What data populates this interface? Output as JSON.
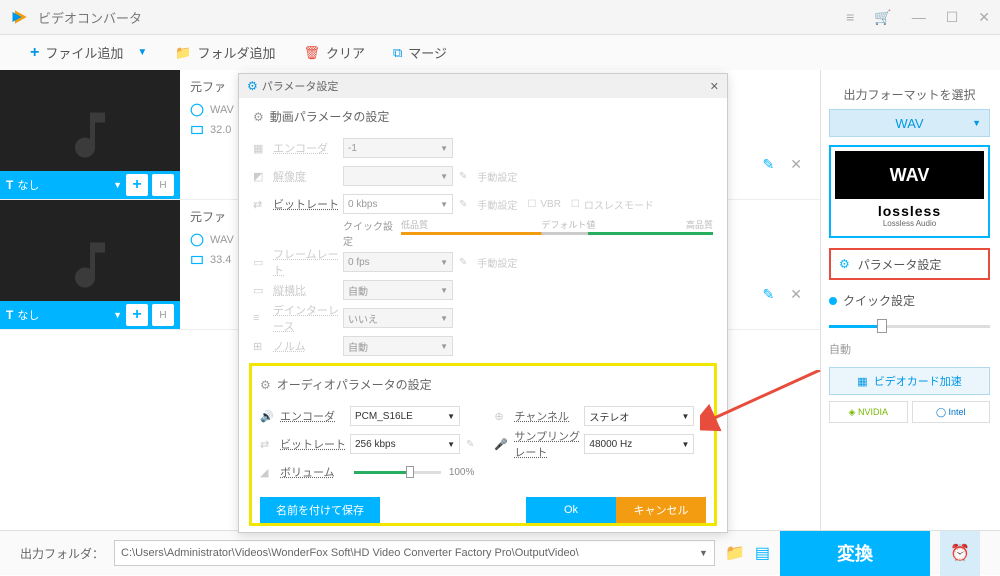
{
  "app": {
    "title": "ビデオコンバータ"
  },
  "toolbar": {
    "add_file": "ファイル追加",
    "add_folder": "フォルダ追加",
    "clear": "クリア",
    "merge": "マージ"
  },
  "files": [
    {
      "name_prefix": "元ファ",
      "fmt": "WAV",
      "size": "32.0",
      "subtitle": "なし"
    },
    {
      "name_prefix": "元ファ",
      "fmt": "WAV",
      "size": "33.4",
      "subtitle": "なし"
    }
  ],
  "sidebar": {
    "title": "出力フォーマットを選択",
    "format": "WAV",
    "card_label": "WAV",
    "lossless": "lossless",
    "lossless_sub": "Lossless Audio",
    "param_btn": "パラメータ設定",
    "quick": "クイック設定",
    "auto": "自動",
    "gpu": "ビデオカード加速",
    "nvidia": "NVIDIA",
    "intel": "Intel"
  },
  "bottom": {
    "label": "出力フォルダ：",
    "path": "C:\\Users\\Administrator\\Videos\\WonderFox Soft\\HD Video Converter Factory Pro\\OutputVideo\\",
    "convert": "変換"
  },
  "dialog": {
    "title": "パラメータ設定",
    "video_section": "動画パラメータの設定",
    "audio_section": "オーディオパラメータの設定",
    "video": {
      "encoder": {
        "label": "エンコーダ",
        "value": "-1"
      },
      "resolution": {
        "label": "解像度",
        "pill": "手動設定"
      },
      "bitrate": {
        "label": "ビットレート",
        "value": "0 kbps",
        "manual": "手動設定",
        "vbr": "VBR",
        "lossless": "ロスレスモード"
      },
      "quick": "クイック設定",
      "low_q": "低品質",
      "def_q": "デフォルト値",
      "high_q": "高品質",
      "fps": {
        "label": "フレームレート",
        "value": "0 fps",
        "pill": "手動設定"
      },
      "aspect": {
        "label": "縦横比",
        "value": "自動"
      },
      "deinterlace": {
        "label": "デインターレース",
        "value": "いいえ"
      },
      "other": {
        "label": "ノルム",
        "value": "自動"
      }
    },
    "audio": {
      "encoder": {
        "label": "エンコーダ",
        "value": "PCM_S16LE"
      },
      "channel": {
        "label": "チャンネル",
        "value": "ステレオ"
      },
      "bitrate": {
        "label": "ビットレート",
        "value": "256 kbps"
      },
      "samplerate": {
        "label": "サンプリングレート",
        "value": "48000 Hz"
      },
      "volume": {
        "label": "ボリューム",
        "pct": "100%"
      }
    },
    "buttons": {
      "save": "名前を付けて保存",
      "ok": "Ok",
      "cancel": "キャンセル"
    }
  }
}
